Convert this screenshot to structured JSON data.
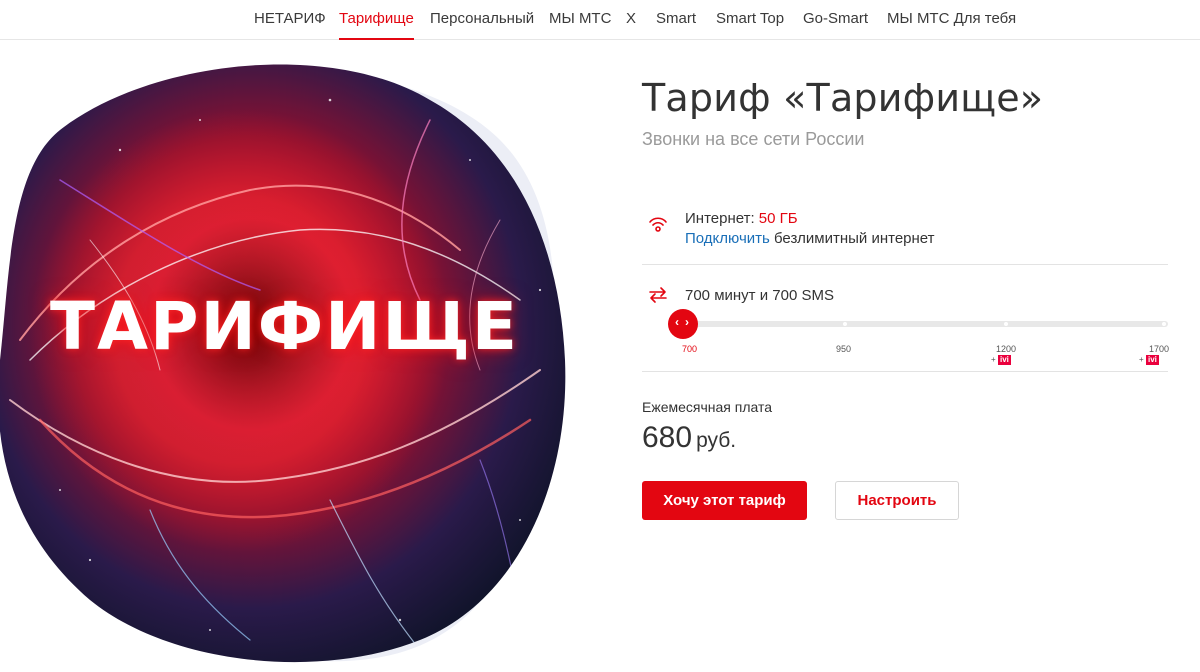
{
  "nav": {
    "items": [
      {
        "label": "НЕТАРИФ"
      },
      {
        "label": "Тарифище",
        "active": true
      },
      {
        "label": "Персональный"
      },
      {
        "label": "МЫ МТС"
      },
      {
        "label": "X"
      },
      {
        "label": "Smart"
      },
      {
        "label": "Smart Top"
      },
      {
        "label": "Go-Smart"
      },
      {
        "label": "МЫ МТС Для тебя"
      }
    ]
  },
  "hero": {
    "word": "ТАРИФИЩЕ"
  },
  "tariff": {
    "title": "Тариф «Тарифище»",
    "subtitle": "Звонки на все сети России"
  },
  "internet": {
    "icon": "wifi-icon",
    "label": "Интернет: ",
    "value": "50 ГБ",
    "link": "Подключить",
    "link_suffix": " безлимитный интернет"
  },
  "minutes": {
    "icon": "exchange-arrows-icon",
    "text": "700 минут и 700 SMS",
    "slider": {
      "selected_value": 700,
      "ticks": [
        {
          "label": "700",
          "active": true
        },
        {
          "label": "950"
        },
        {
          "label": "1200",
          "ivi": true
        },
        {
          "label": "1700",
          "ivi": true
        }
      ],
      "ivi_plus": "+",
      "ivi_badge": "ivi"
    }
  },
  "fee": {
    "label": "Ежемесячная плата",
    "amount": "680",
    "unit": "руб."
  },
  "buttons": {
    "primary": "Хочу этот тариф",
    "secondary": "Настроить"
  },
  "colors": {
    "accent": "#e30611",
    "link": "#1a6fb8",
    "ivi": "#ea003d"
  }
}
